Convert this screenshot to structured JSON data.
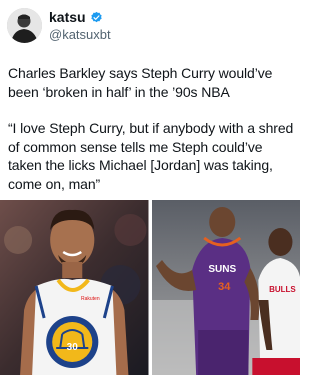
{
  "author": {
    "display_name": "katsu",
    "handle": "@katsuxbt",
    "avatar_icon": "avatar-portrait",
    "verified_icon": "verified-badge-icon",
    "verified_color": "#1d9bf0"
  },
  "post": {
    "paragraph_1": "Charles Barkley says Steph Curry would’ve been ‘broken in half’ in the ’90s NBA",
    "paragraph_2": "“I love Steph Curry, but if anybody with a shred of common sense tells me Steph could’ve taken the licks Michael [Jordan] was taking, come on, man”"
  },
  "media": {
    "left_photo": {
      "subject": "steph-curry-photo",
      "jersey_team": "GOLDEN STATE",
      "jersey_number": "30",
      "jersey_bottom": "WARRIORS",
      "sponsor": "Rakuten"
    },
    "right_photo": {
      "subject": "barkley-jordan-photo",
      "barkley_team": "SUNS",
      "barkley_number": "34",
      "jordan_team": "BULLS"
    }
  }
}
